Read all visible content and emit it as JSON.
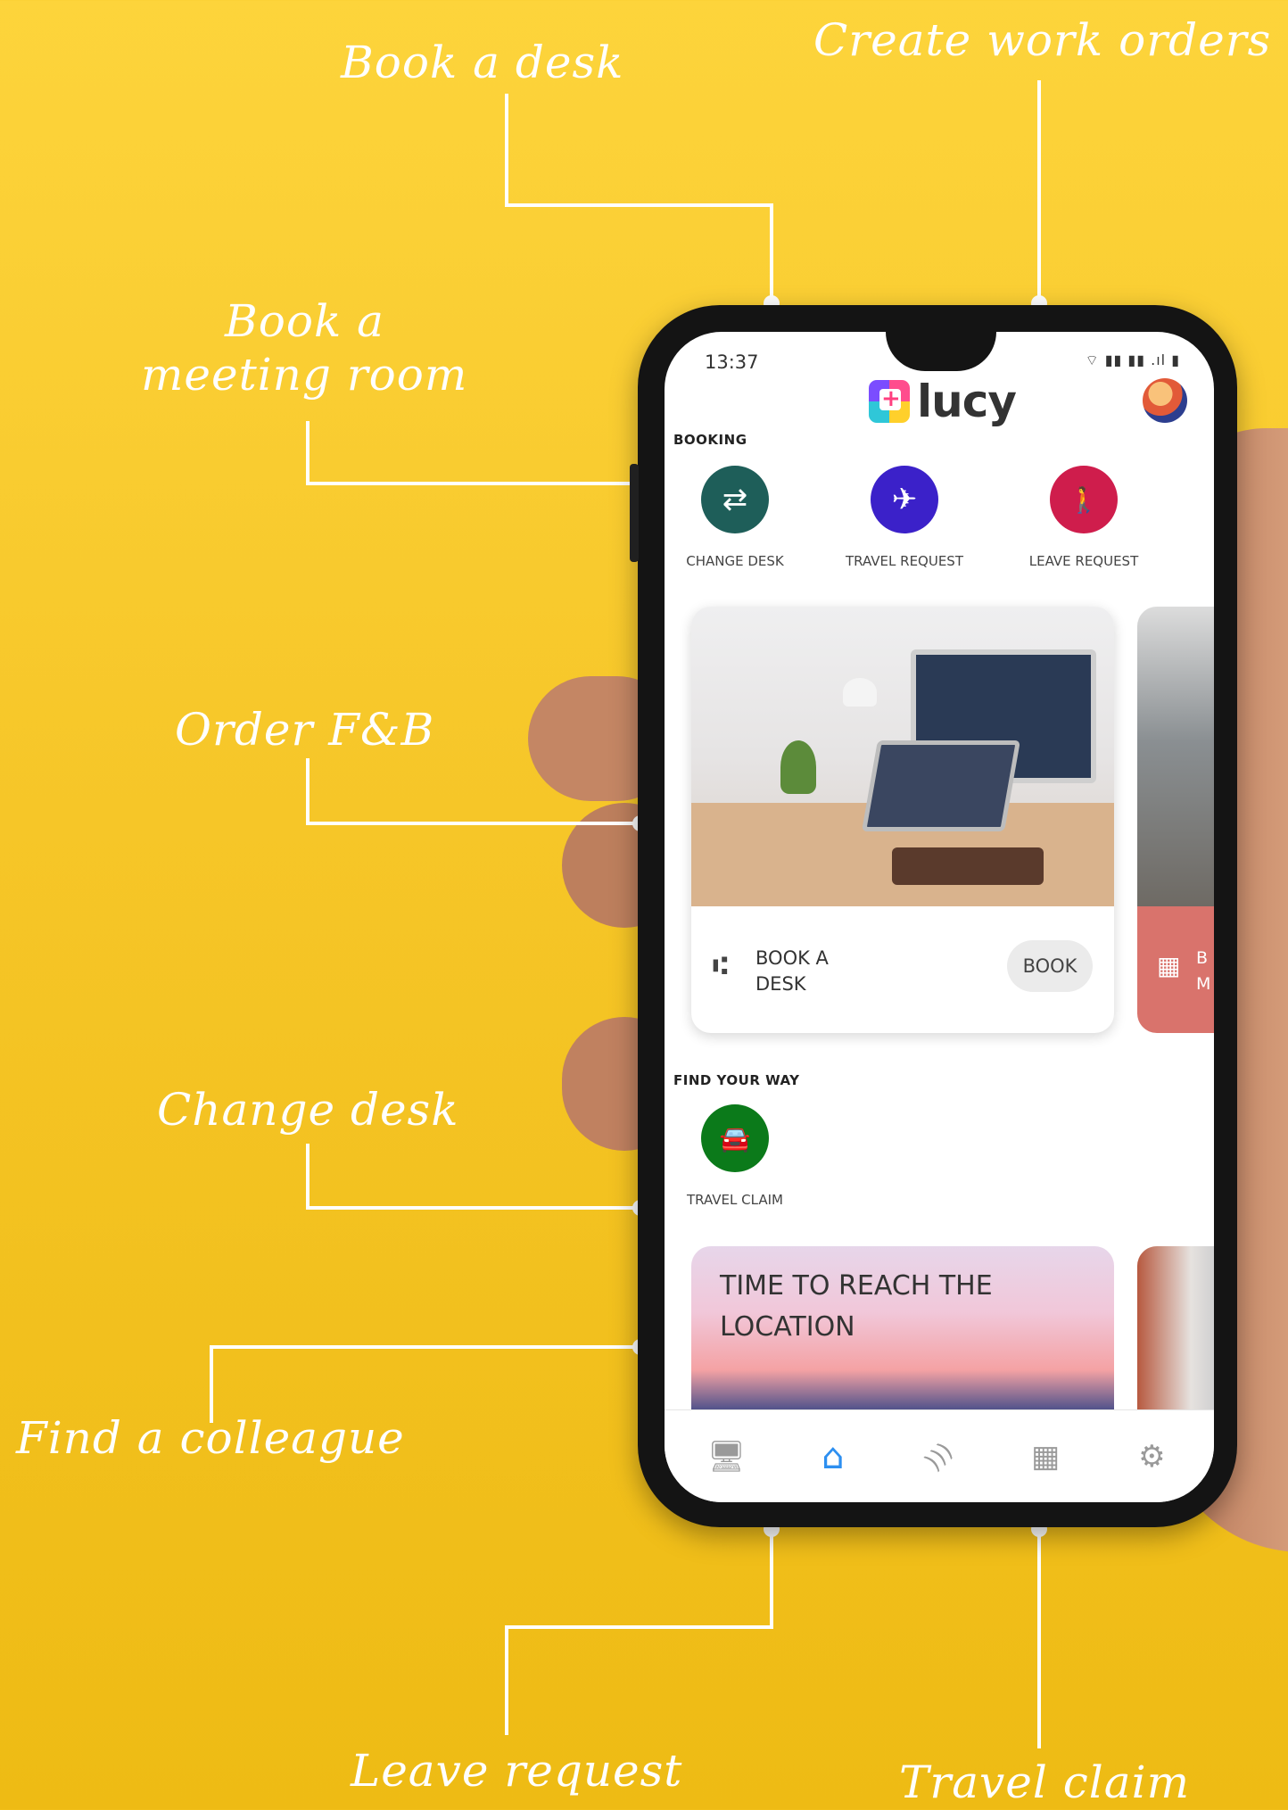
{
  "callouts": {
    "book_desk": "Book a desk",
    "create_work_orders": "Create work orders",
    "meeting_room_line1": "Book a",
    "meeting_room_line2": "meeting room",
    "order_fb": "Order F&B",
    "change_desk": "Change desk",
    "find_colleague": "Find a colleague",
    "leave_request": "Leave request",
    "travel_claim": "Travel claim"
  },
  "status_bar": {
    "time": "13:37",
    "icons": "⌔ ▮▮ ▮▮ .ıl ▮"
  },
  "app": {
    "name": "lucy",
    "logo_icon": "plus-badge-icon",
    "avatar_icon": "user-avatar"
  },
  "booking": {
    "section_label": "BOOKING",
    "actions": [
      {
        "label": "CHANGE DESK",
        "icon": "swap-arrows-icon",
        "glyph": "⇄",
        "color": "#1e5e59"
      },
      {
        "label": "TRAVEL REQUEST",
        "icon": "airplane-icon",
        "glyph": "✈",
        "color": "#3b21c9"
      },
      {
        "label": "LEAVE REQUEST",
        "icon": "walking-person-icon",
        "glyph": "🚶",
        "color": "#cf1d4c"
      }
    ]
  },
  "desk_card": {
    "title": "BOOK A DESK",
    "icon": "chair-icon",
    "button": "BOOK"
  },
  "meeting_card_peek": {
    "icon": "calendar-icon",
    "text_line1": "B",
    "text_line2": "M",
    "color": "#d9736c"
  },
  "find_your_way": {
    "section_label": "FIND YOUR WAY",
    "actions": [
      {
        "label": "TRAVEL CLAIM",
        "icon": "car-icon",
        "glyph": "🚘",
        "color": "#0b7a1a"
      }
    ]
  },
  "time_card": {
    "title": "TIME TO REACH THE LOCATION"
  },
  "bottom_nav": [
    {
      "name": "reception-icon",
      "glyph": "🖥",
      "active": false
    },
    {
      "name": "home-icon",
      "glyph": "⌂",
      "active": true
    },
    {
      "name": "feed-icon",
      "glyph": ")))",
      "active": false
    },
    {
      "name": "qr-code-icon",
      "glyph": "▦",
      "active": false
    },
    {
      "name": "settings-gear-icon",
      "glyph": "⚙",
      "active": false
    }
  ]
}
